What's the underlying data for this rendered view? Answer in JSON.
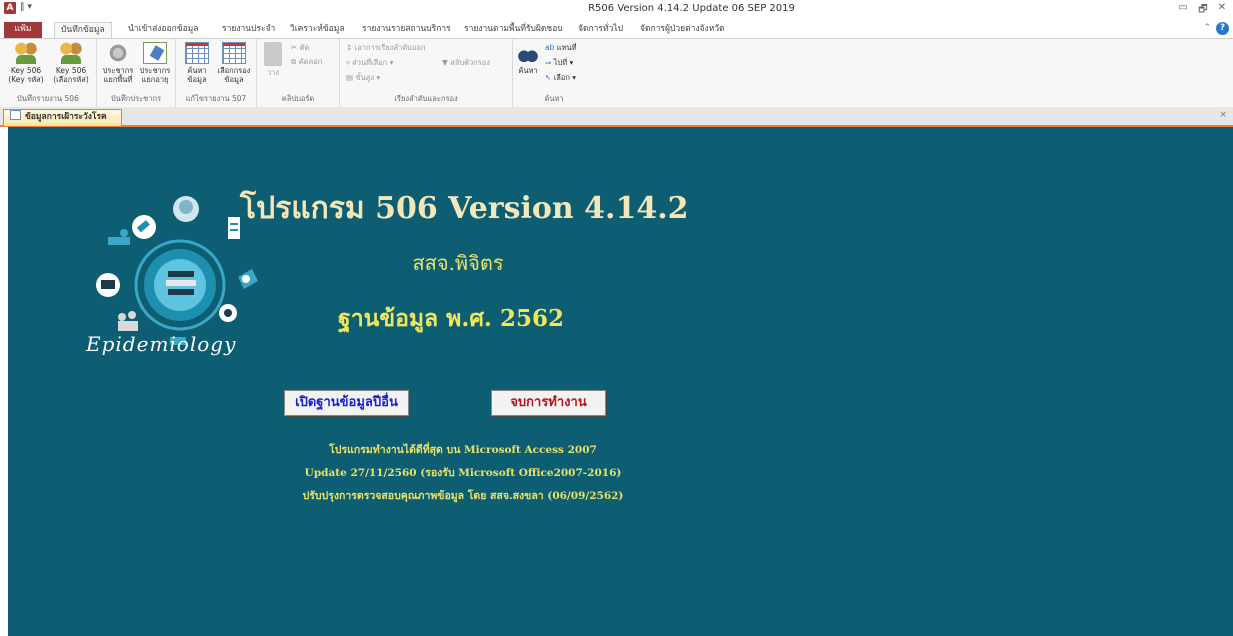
{
  "titlebar": {
    "app_icon": "A",
    "qat": "‖ ▾",
    "title": "R506 Version 4.14.2  Update 06 SEP 2019",
    "controls": [
      "▭",
      "🗗",
      "✕"
    ]
  },
  "ribbon_tabs": {
    "file": "แฟ้ม",
    "tabs": [
      "บันทึกข้อมูล",
      "นำเข้าส่งออกข้อมูล",
      "รายงานประจำ",
      "วิเคราะห์ข้อมูล",
      "รายงานรายสถานบริการ",
      "รายงานตามพื้นที่รับผิดชอบ",
      "จัดการทั่วไป",
      "จัดการผู้ป่วยต่างจังหวัด"
    ],
    "active_index": 0
  },
  "ribbon": {
    "groups": [
      {
        "label": "บันทึกรายงาน 506",
        "buttons": [
          {
            "label1": "Key 506",
            "label2": "(Key รหัส)",
            "icon": "people-icon"
          },
          {
            "label1": "Key 506",
            "label2": "(เลือกรหัส)",
            "icon": "people-icon"
          }
        ]
      },
      {
        "label": "บันทึกประชากร",
        "buttons": [
          {
            "label1": "ประชากร",
            "label2": "แยกพื้นที่",
            "icon": "gear-sheet-icon"
          },
          {
            "label1": "ประชากร",
            "label2": "แยกอายุ",
            "icon": "edit-sheet-icon"
          }
        ]
      },
      {
        "label": "แก้ไขรายงาน 507",
        "buttons": [
          {
            "label1": "ค้นหา",
            "label2": "ข้อมูล",
            "icon": "grid-icon"
          },
          {
            "label1": "เลือกกรอง",
            "label2": "ข้อมูล",
            "icon": "grid-icon"
          }
        ]
      },
      {
        "label": "คลิปบอร์ด",
        "paste": "วาง",
        "items": [
          "ตัด",
          "คัดลอก",
          ""
        ]
      },
      {
        "label": "เรียงลำดับและกรอง",
        "items": [
          "เอาการเรียงลำดับออก",
          "ส่วนที่เลือก ▾",
          "ขั้นสูง ▾",
          "สลับตัวกรอง"
        ]
      },
      {
        "label": "ค้นหา",
        "find": "ค้นหา",
        "items": [
          "แทนที่",
          "ไปที่ ▾",
          "เลือก ▾"
        ]
      }
    ]
  },
  "doc_tab": {
    "label": "ข้อมูลการเฝ้าระวังโรค",
    "close": "×"
  },
  "main": {
    "logo_text": "Epidemiology",
    "title": "โปรแกรม 506 Version 4.14.2",
    "org": "สสจ.พิจิตร",
    "db_year": "ฐานข้อมูล พ.ศ. 2562",
    "open_button": "เปิดฐานข้อมูลปีอื่น",
    "exit_button": "จบการทำงาน",
    "notes": [
      "โปรแกรมทำงานได้ดีที่สุด บน Microsoft Access 2007",
      "Update  27/11/2560  (รองรับ Microsoft Office2007-2016)",
      "ปรับปรุงการตรวจสอบคุณภาพข้อมูล โดย สสจ.สงขลา (06/09/2562)"
    ]
  },
  "colors": {
    "background": "#0d5e72",
    "title": "#f5e6b8",
    "accent": "#e8e26a",
    "file_tab": "#a4373a"
  }
}
